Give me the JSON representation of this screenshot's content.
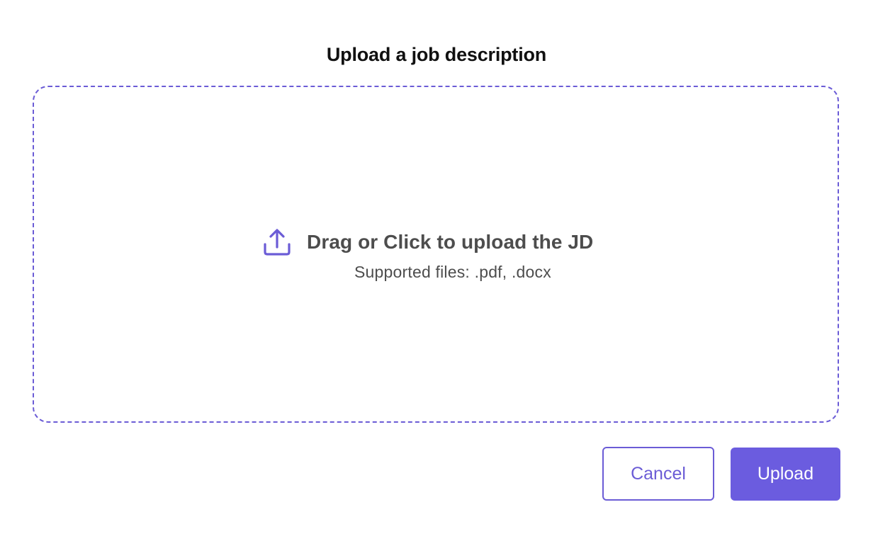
{
  "dialog": {
    "title": "Upload a job description"
  },
  "dropzone": {
    "label": "Drag or Click to upload the JD",
    "supported": "Supported files: .pdf, .docx",
    "icon": "upload-icon"
  },
  "actions": {
    "cancel_label": "Cancel",
    "upload_label": "Upload"
  },
  "colors": {
    "accent": "#6b5cd6",
    "primary_button": "#6b5cdf",
    "text_dark": "#111111",
    "text_muted": "#4d4d4d"
  }
}
